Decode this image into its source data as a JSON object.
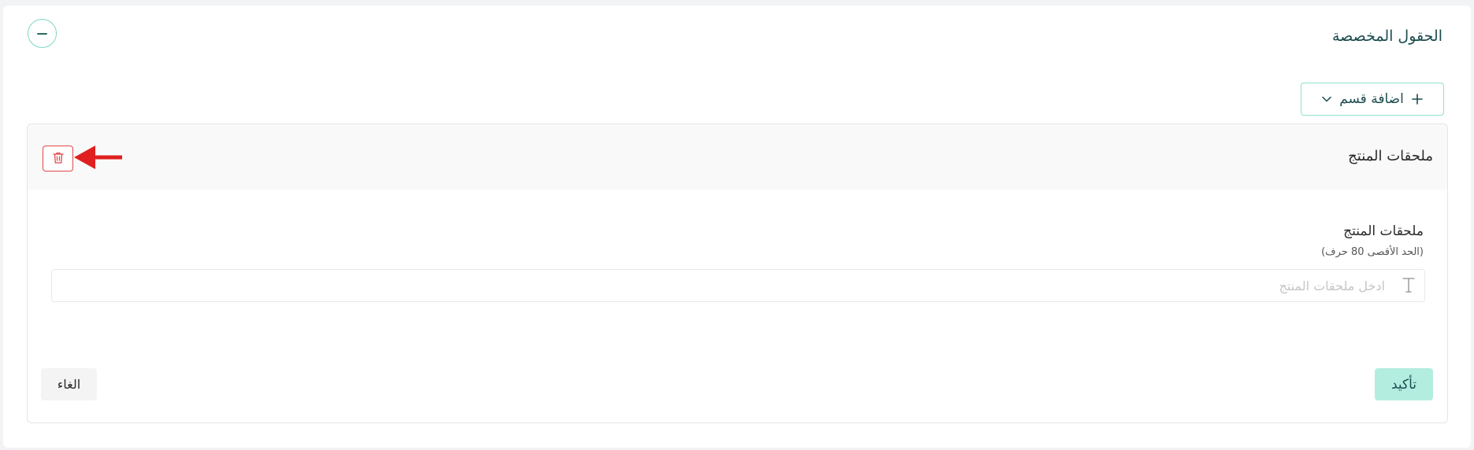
{
  "panel": {
    "title": "الحقول المخصصة"
  },
  "toolbar": {
    "add_section_label": "اضافة قسم"
  },
  "section": {
    "title": "ملحقات المنتج",
    "field": {
      "label": "ملحقات المنتج",
      "hint": "(الحد الأقصى 80 حرف)",
      "placeholder": "ادخل ملحقات المنتج",
      "value": ""
    },
    "confirm_label": "تأكيد",
    "cancel_label": "الغاء"
  },
  "icons": {
    "collapse": "minus-icon",
    "add": "plus-icon",
    "dropdown": "chevron-down-icon",
    "delete": "trash-icon",
    "text_type": "text-t-icon",
    "annotation": "red-arrow-icon"
  },
  "colors": {
    "accent": "#8fe0cf",
    "primary_text": "#1c4c4e",
    "confirm_bg": "#b3ede0",
    "danger": "#e64545",
    "annotation_red": "#e02020"
  }
}
